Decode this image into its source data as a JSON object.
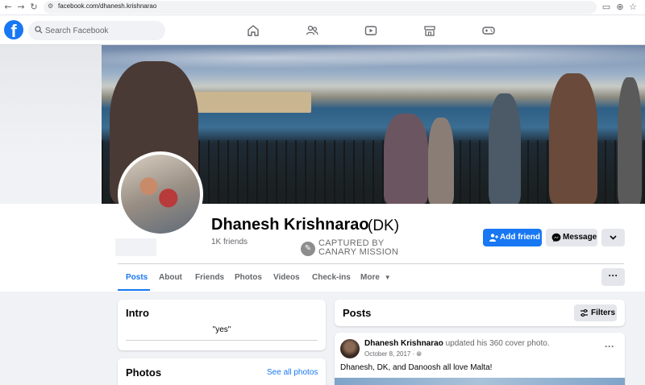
{
  "browser": {
    "url": "facebook.com/dhanesh.krishnarao",
    "back_icon": "arrow-left-icon",
    "forward_icon": "arrow-right-icon",
    "reload_icon": "reload-icon"
  },
  "header": {
    "logo": "f",
    "search_placeholder": "Search Facebook",
    "nav_icons": [
      "home-icon",
      "friends-icon",
      "watch-icon",
      "marketplace-icon",
      "gaming-icon"
    ]
  },
  "profile": {
    "name": "Dhanesh Krishnarao",
    "alternate_name": "(DK)",
    "friends": "1K friends",
    "stamp_line1": "CAPTURED BY",
    "stamp_line2": "CANARY MISSION",
    "add_friend_label": "Add friend",
    "message_label": "Message"
  },
  "tabs": [
    {
      "label": "Posts",
      "active": true
    },
    {
      "label": "About"
    },
    {
      "label": "Friends"
    },
    {
      "label": "Photos"
    },
    {
      "label": "Videos"
    },
    {
      "label": "Check-ins"
    },
    {
      "label": "More"
    }
  ],
  "intro": {
    "title": "Intro",
    "bio": "\"yes\""
  },
  "photos": {
    "title": "Photos",
    "see_all": "See all photos"
  },
  "posts": {
    "title": "Posts",
    "filters_label": "Filters",
    "items": [
      {
        "author": "Dhanesh Krishnarao",
        "action": "updated his 360 cover photo.",
        "date": "October 8, 2017",
        "separator": "·",
        "text": "Dhanesh, DK, and Danoosh all love Malta!"
      }
    ]
  },
  "colors": {
    "brand": "#1877f2",
    "background": "#f0f2f5",
    "secondary_button": "#e4e6eb"
  }
}
